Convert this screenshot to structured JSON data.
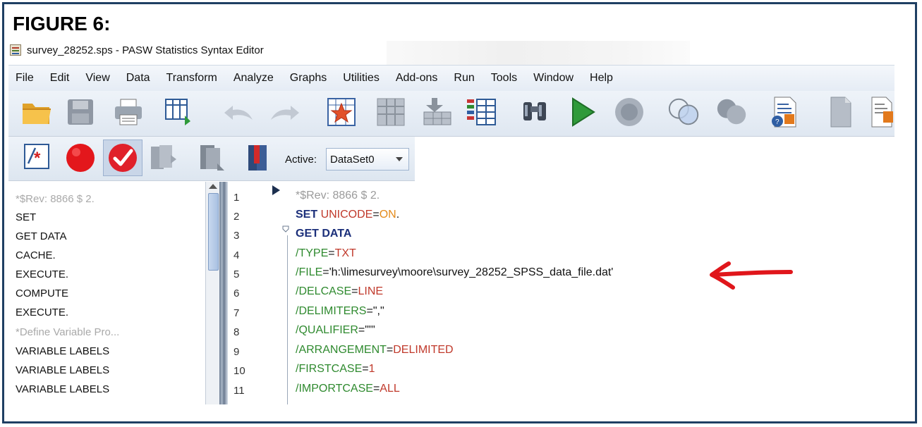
{
  "figure_label": "FIGURE 6:",
  "window": {
    "title": "survey_28252.sps - PASW Statistics Syntax Editor"
  },
  "menu": [
    "File",
    "Edit",
    "View",
    "Data",
    "Transform",
    "Analyze",
    "Graphs",
    "Utilities",
    "Add-ons",
    "Run",
    "Tools",
    "Window",
    "Help"
  ],
  "toolbar1_icons": [
    "open-folder-icon",
    "save-disk-icon",
    "print-icon",
    "goto-data-icon",
    "undo-icon",
    "redo-icon",
    "goto-case-star-icon",
    "variables-icon",
    "insert-cases-icon",
    "split-file-icon",
    "find-binoculars-icon",
    "run-play-icon",
    "stop-icon",
    "select-cases-icon",
    "weight-cases-icon",
    "script-icon",
    "doc-icon",
    "doc-icon-2"
  ],
  "toolbar2_icons": [
    "comment-syntax-icon",
    "breakpoint-icon",
    "validate-check-icon",
    "bookmark-icon",
    "bookmark-next-icon",
    "book-icon"
  ],
  "active_dataset": {
    "label": "Active:",
    "value": "DataSet0"
  },
  "navigation": [
    {
      "text": "*$Rev: 8866 $  2.",
      "dim": true
    },
    {
      "text": "SET",
      "dim": false
    },
    {
      "text": "GET DATA",
      "dim": false
    },
    {
      "text": "CACHE.",
      "dim": false
    },
    {
      "text": "EXECUTE.",
      "dim": false
    },
    {
      "text": "COMPUTE",
      "dim": false
    },
    {
      "text": "EXECUTE.",
      "dim": false
    },
    {
      "text": "*Define Variable Pro...",
      "dim": true
    },
    {
      "text": "VARIABLE LABELS",
      "dim": false
    },
    {
      "text": "VARIABLE LABELS",
      "dim": false
    },
    {
      "text": "VARIABLE LABELS",
      "dim": false
    }
  ],
  "line_numbers": [
    "1",
    "2",
    "3",
    "4",
    "5",
    "6",
    "7",
    "8",
    "9",
    "10",
    "11"
  ],
  "code": {
    "l1": "*$Rev: 8866 $  2.",
    "l2a": "SET",
    "l2b": " UNICODE",
    "l2c": "=",
    "l2d": "ON",
    "l2e": ".",
    "l3": "GET DATA",
    "l4a": " /TYPE",
    "l4b": "=",
    "l4c": "TXT",
    "l5a": " /FILE",
    "l5b": "=",
    "l5c": "'h:\\limesurvey\\moore\\survey_28252_SPSS_data_file.dat'",
    "l6a": " /DELCASE",
    "l6b": "=",
    "l6c": "LINE",
    "l7a": " /DELIMITERS",
    "l7b": "=",
    "l7c": "\",\"",
    "l8a": " /QUALIFIER",
    "l8b": "=",
    "l8c": "\"'\"",
    "l9a": " /ARRANGEMENT",
    "l9b": "=",
    "l9c": "DELIMITED",
    "l10a": " /FIRSTCASE",
    "l10b": "=",
    "l10c": "1",
    "l11a": " /IMPORTCASE",
    "l11b": "=",
    "l11c": "ALL"
  },
  "colors": {
    "annotation": "#e0161b",
    "keyword": "#1b2f7a",
    "subcommand": "#2f8a2f",
    "value": "#c0392b"
  }
}
